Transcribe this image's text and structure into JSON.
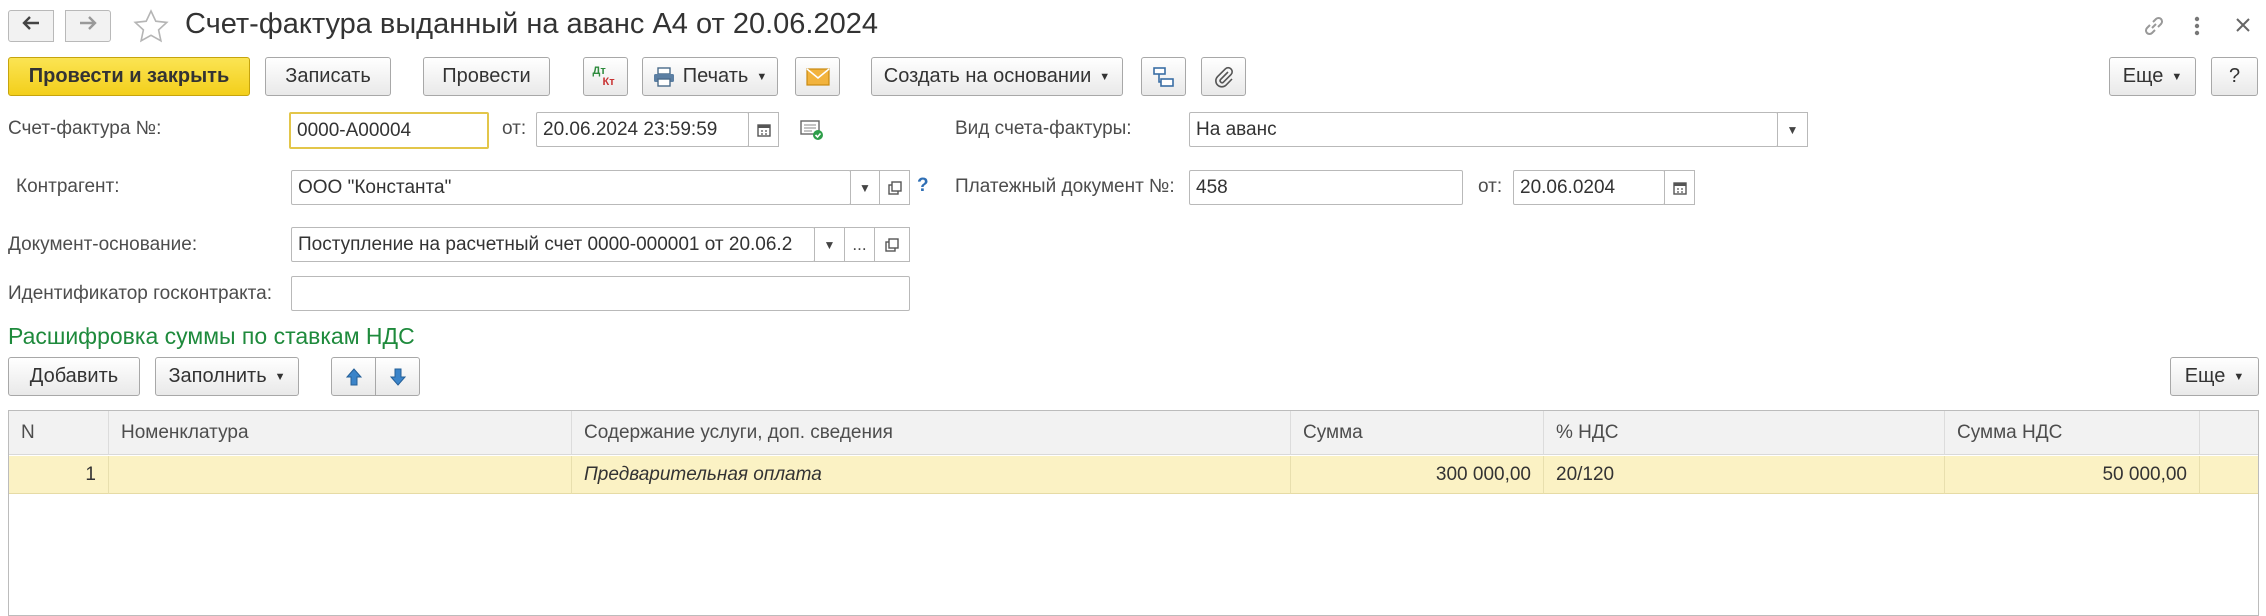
{
  "header": {
    "title": "Счет-фактура выданный на аванс А4 от 20.06.2024"
  },
  "toolbar": {
    "post_close": "Провести и закрыть",
    "save": "Записать",
    "post": "Провести",
    "dtkt_top": "Дт",
    "dtkt_bottom": "Кт",
    "print": "Печать",
    "create_based": "Создать на основании",
    "more": "Еще",
    "help": "?"
  },
  "form": {
    "invoice_label": "Счет-фактура №:",
    "invoice_number": "0000-А00004",
    "from_label": "от:",
    "invoice_date": "20.06.2024 23:59:59",
    "type_label": "Вид счета-фактуры:",
    "type_value": "На аванс",
    "counterparty_label": "Контрагент:",
    "counterparty_value": "ООО \"Константа\"",
    "help_mark": "?",
    "payment_doc_label": "Платежный документ №:",
    "payment_doc_value": "458",
    "payment_from_label": "от:",
    "payment_date": "20.06.0204",
    "base_doc_label": "Документ-основание:",
    "base_doc_value": "Поступление на расчетный счет 0000-000001 от 20.06.2",
    "ellipsis": "...",
    "contract_id_label": "Идентификатор госконтракта:",
    "contract_id_value": ""
  },
  "section": {
    "title": "Расшифровка суммы по ставкам НДС"
  },
  "table_toolbar": {
    "add": "Добавить",
    "fill": "Заполнить",
    "more": "Еще"
  },
  "table": {
    "columns": [
      "N",
      "Номенклатура",
      "Содержание услуги, доп. сведения",
      "Сумма",
      "% НДС",
      "Сумма НДС"
    ],
    "rows": [
      {
        "n": "1",
        "item": "",
        "content": "Предварительная оплата",
        "sum": "300 000,00",
        "rate": "20/120",
        "vat": "50 000,00"
      }
    ]
  },
  "colors": {
    "primary_button": "#f3cf1b",
    "section_title": "#1e8a3c",
    "row_highlight": "#fbf2c4",
    "focus_border": "#e3c64a"
  }
}
